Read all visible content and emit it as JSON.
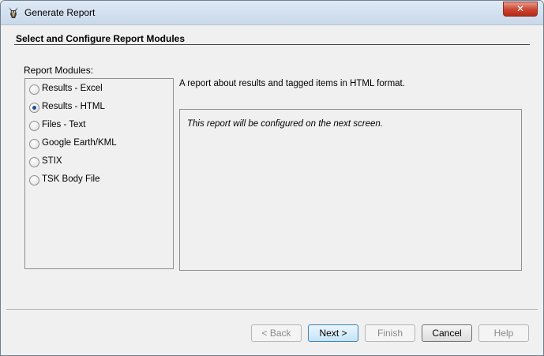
{
  "window": {
    "title": "Generate Report",
    "close_glyph": "✕"
  },
  "section": {
    "title": "Select and Configure Report Modules"
  },
  "modules": {
    "label": "Report Modules:",
    "items": [
      {
        "label": "Results - Excel",
        "selected": false
      },
      {
        "label": "Results - HTML",
        "selected": true
      },
      {
        "label": "Files - Text",
        "selected": false
      },
      {
        "label": "Google Earth/KML",
        "selected": false
      },
      {
        "label": "STIX",
        "selected": false
      },
      {
        "label": "TSK Body File",
        "selected": false
      }
    ]
  },
  "details": {
    "description": "A report about results and tagged items in HTML format.",
    "config_note": "This report will be configured on the next screen."
  },
  "buttons": {
    "back": "< Back",
    "next": "Next >",
    "finish": "Finish",
    "cancel": "Cancel",
    "help": "Help"
  },
  "icons": {
    "app": "autopsy-dog-icon",
    "close": "close-icon"
  },
  "colors": {
    "close_button": "#c9442f",
    "radio_dot": "#1f4f9a",
    "default_button_border": "#3c7fb1"
  }
}
